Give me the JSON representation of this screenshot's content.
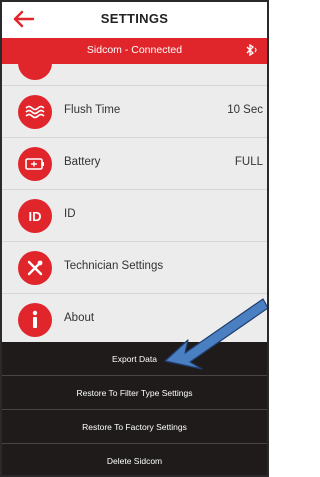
{
  "header": {
    "title": "SETTINGS"
  },
  "status": {
    "text": "Sidcom - Connected",
    "bluetooth_glyph": "✱)"
  },
  "rows": [
    {
      "label": "Flush Time",
      "value": "10 Sec",
      "icon": "waves-icon"
    },
    {
      "label": "Battery",
      "value": "FULL",
      "icon": "battery-icon"
    },
    {
      "label": "ID",
      "value": "",
      "icon_text": "ID",
      "icon": "id-icon"
    },
    {
      "label": "Technician Settings",
      "value": "",
      "icon": "tools-icon"
    },
    {
      "label": "About",
      "value": "",
      "icon": "info-icon"
    }
  ],
  "menu": [
    {
      "label": "Export Data"
    },
    {
      "label": "Restore To Filter Type Settings"
    },
    {
      "label": "Restore To Factory Settings"
    },
    {
      "label": "Delete Sidcom"
    }
  ],
  "colors": {
    "accent": "#e0262b",
    "menu_bg": "#1f1b1b",
    "row_bg": "#ececec",
    "arrow": "#4a7fc1"
  }
}
